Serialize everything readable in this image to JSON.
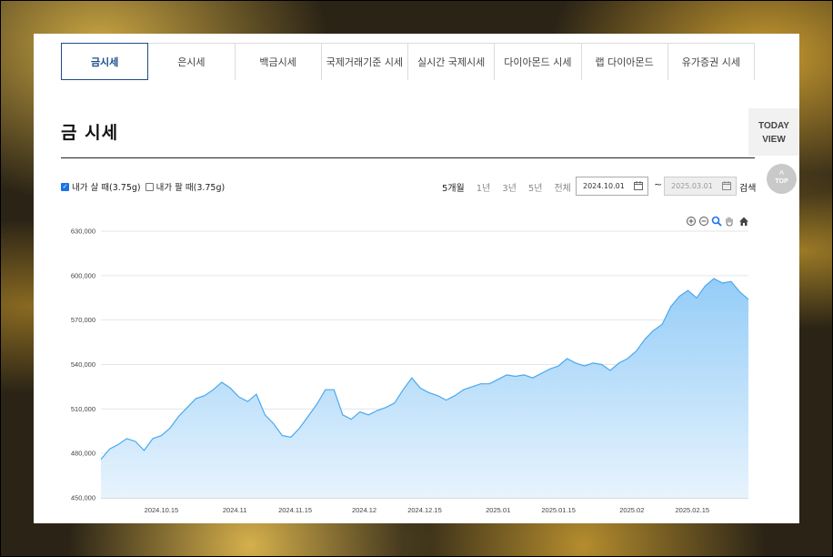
{
  "tabs": [
    {
      "label": "금시세",
      "active": true
    },
    {
      "label": "은시세"
    },
    {
      "label": "백금시세"
    },
    {
      "label": "국제거래기준 시세"
    },
    {
      "label": "실시간 국제시세"
    },
    {
      "label": "다이아몬드 시세"
    },
    {
      "label": "랩 다이아몬드"
    },
    {
      "label": "유가증권 시세"
    }
  ],
  "page_title": "금 시세",
  "sidebar": {
    "today_view_line1": "TODAY",
    "today_view_line2": "VIEW",
    "top_label": "TOP"
  },
  "filters": {
    "buy_label": "내가 살 때(3.75g)",
    "buy_checked": true,
    "sell_label": "내가 팔 때(3.75g)",
    "sell_checked": false
  },
  "periods": [
    {
      "label": "5개월",
      "selected": true
    },
    {
      "label": "1년"
    },
    {
      "label": "3년"
    },
    {
      "label": "5년"
    },
    {
      "label": "전체"
    }
  ],
  "date_range": {
    "start": "2024.10.01",
    "separator": "~",
    "end": "2025.03.01",
    "search_label": "검색"
  },
  "chart_icons": [
    "zoom-in-icon",
    "zoom-out-icon",
    "magnify-icon",
    "pan-hand-icon",
    "home-icon"
  ],
  "colors": {
    "accent": "#1c4d8c",
    "series_line": "#4aa8ef",
    "area_top": "#8fcaf7",
    "area_bottom": "#e6f3fd"
  },
  "chart_data": {
    "type": "area",
    "ylim": [
      450000,
      630000
    ],
    "y_ticks": [
      "630,000",
      "600,000",
      "570,000",
      "540,000",
      "510,000",
      "480,000",
      "450,000"
    ],
    "x_ticks": [
      "2024.10.15",
      "2024.11",
      "2024.11.15",
      "2024.12",
      "2024.12.15",
      "2025.01",
      "2025.01.15",
      "2025.02",
      "2025.02.15"
    ],
    "grid": true,
    "x_start": "2024-10-01",
    "x_end": "2025-02-28",
    "points": [
      [
        "2024-10-01",
        476000
      ],
      [
        "2024-10-03",
        483000
      ],
      [
        "2024-10-05",
        486000
      ],
      [
        "2024-10-07",
        490000
      ],
      [
        "2024-10-09",
        488000
      ],
      [
        "2024-10-11",
        482000
      ],
      [
        "2024-10-13",
        490000
      ],
      [
        "2024-10-15",
        492000
      ],
      [
        "2024-10-17",
        497000
      ],
      [
        "2024-10-19",
        505000
      ],
      [
        "2024-10-21",
        511000
      ],
      [
        "2024-10-23",
        517000
      ],
      [
        "2024-10-25",
        519000
      ],
      [
        "2024-10-27",
        523000
      ],
      [
        "2024-10-29",
        528000
      ],
      [
        "2024-10-31",
        524000
      ],
      [
        "2024-11-02",
        518000
      ],
      [
        "2024-11-04",
        515000
      ],
      [
        "2024-11-06",
        520000
      ],
      [
        "2024-11-08",
        506000
      ],
      [
        "2024-11-10",
        500000
      ],
      [
        "2024-11-12",
        492000
      ],
      [
        "2024-11-14",
        491000
      ],
      [
        "2024-11-16",
        497000
      ],
      [
        "2024-11-18",
        505000
      ],
      [
        "2024-11-20",
        513000
      ],
      [
        "2024-11-22",
        523000
      ],
      [
        "2024-11-24",
        523000
      ],
      [
        "2024-11-26",
        506000
      ],
      [
        "2024-11-28",
        503000
      ],
      [
        "2024-11-30",
        508000
      ],
      [
        "2024-12-02",
        506000
      ],
      [
        "2024-12-04",
        509000
      ],
      [
        "2024-12-06",
        511000
      ],
      [
        "2024-12-08",
        514000
      ],
      [
        "2024-12-10",
        523000
      ],
      [
        "2024-12-12",
        531000
      ],
      [
        "2024-12-14",
        524000
      ],
      [
        "2024-12-16",
        521000
      ],
      [
        "2024-12-18",
        519000
      ],
      [
        "2024-12-20",
        516000
      ],
      [
        "2024-12-22",
        519000
      ],
      [
        "2024-12-24",
        523000
      ],
      [
        "2024-12-26",
        525000
      ],
      [
        "2024-12-28",
        527000
      ],
      [
        "2024-12-30",
        527000
      ],
      [
        "2025-01-01",
        530000
      ],
      [
        "2025-01-03",
        533000
      ],
      [
        "2025-01-05",
        532000
      ],
      [
        "2025-01-07",
        533000
      ],
      [
        "2025-01-09",
        531000
      ],
      [
        "2025-01-11",
        534000
      ],
      [
        "2025-01-13",
        537000
      ],
      [
        "2025-01-15",
        539000
      ],
      [
        "2025-01-17",
        544000
      ],
      [
        "2025-01-19",
        541000
      ],
      [
        "2025-01-21",
        539000
      ],
      [
        "2025-01-23",
        541000
      ],
      [
        "2025-01-25",
        540000
      ],
      [
        "2025-01-27",
        536000
      ],
      [
        "2025-01-29",
        541000
      ],
      [
        "2025-01-31",
        544000
      ],
      [
        "2025-02-02",
        549000
      ],
      [
        "2025-02-04",
        557000
      ],
      [
        "2025-02-06",
        563000
      ],
      [
        "2025-02-08",
        567000
      ],
      [
        "2025-02-10",
        579000
      ],
      [
        "2025-02-12",
        586000
      ],
      [
        "2025-02-14",
        590000
      ],
      [
        "2025-02-16",
        585000
      ],
      [
        "2025-02-18",
        593000
      ],
      [
        "2025-02-20",
        598000
      ],
      [
        "2025-02-22",
        595000
      ],
      [
        "2025-02-24",
        596000
      ],
      [
        "2025-02-26",
        589000
      ],
      [
        "2025-02-28",
        584000
      ]
    ]
  }
}
